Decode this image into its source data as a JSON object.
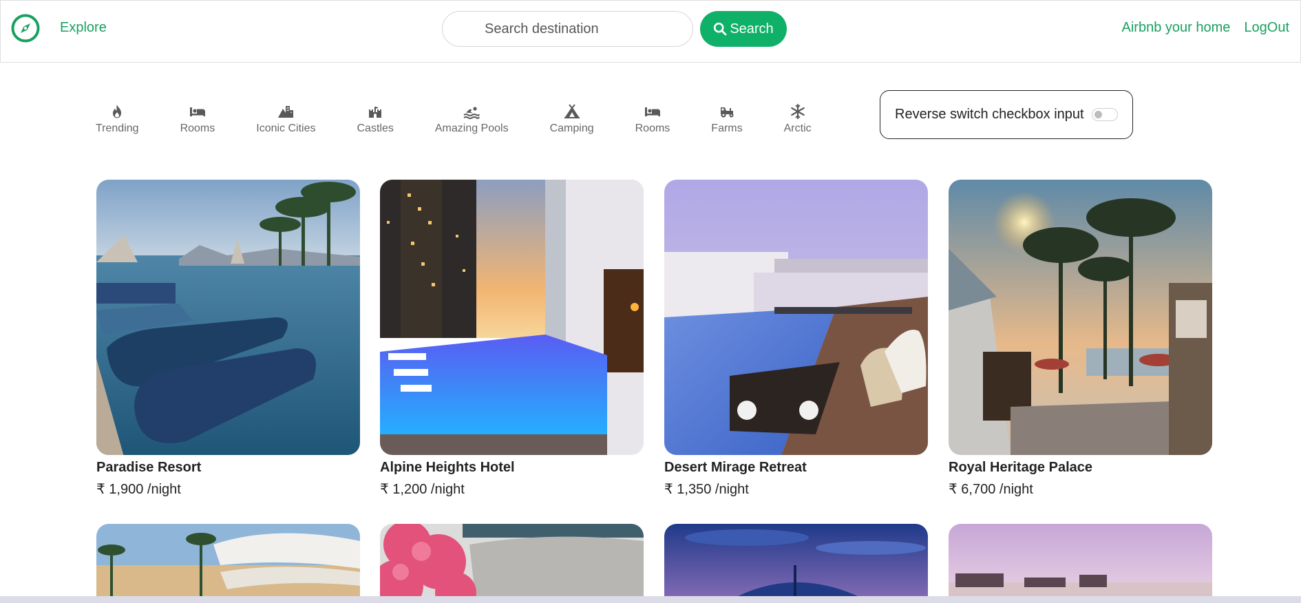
{
  "nav": {
    "explore_label": "Explore",
    "search_placeholder": "Search destination",
    "search_button_label": "Search",
    "host_label": "Airbnb your home",
    "logout_label": "LogOut",
    "brand_color": "#0fb067"
  },
  "filters": [
    {
      "icon": "fire-icon",
      "label": "Trending"
    },
    {
      "icon": "bed-icon",
      "label": "Rooms"
    },
    {
      "icon": "mountain-city-icon",
      "label": "Iconic Cities"
    },
    {
      "icon": "fort-icon",
      "label": "Castles"
    },
    {
      "icon": "person-swimming-icon",
      "label": "Amazing Pools"
    },
    {
      "icon": "campground-icon",
      "label": "Camping"
    },
    {
      "icon": "bed-icon",
      "label": "Rooms"
    },
    {
      "icon": "tractor-icon",
      "label": "Farms"
    },
    {
      "icon": "snowflake-icon",
      "label": "Arctic"
    }
  ],
  "tax_toggle": {
    "label": "Reverse switch checkbox input",
    "checked": false
  },
  "listings": [
    {
      "title": "Paradise Resort",
      "price": "₹ 1,900 /night"
    },
    {
      "title": "Alpine Heights Hotel",
      "price": "₹ 1,200 /night"
    },
    {
      "title": "Desert Mirage Retreat",
      "price": "₹ 1,350 /night"
    },
    {
      "title": "Royal Heritage Palace",
      "price": "₹ 6,700 /night"
    }
  ]
}
